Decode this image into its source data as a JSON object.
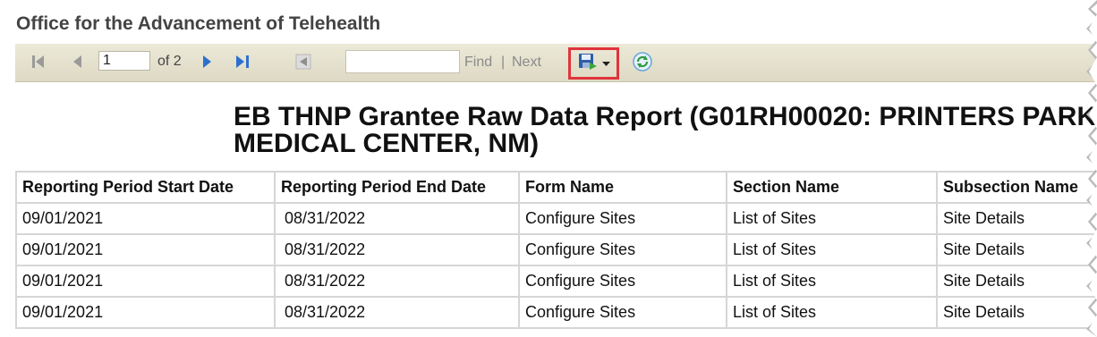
{
  "app": {
    "title": "Office for the Advancement of Telehealth"
  },
  "toolbar": {
    "page_current": "1",
    "page_of": "of 2",
    "find_placeholder": "",
    "find_label": "Find",
    "separator": "|",
    "next_label": "Next",
    "icons": [
      "first-page-icon",
      "previous-page-icon",
      "next-page-icon",
      "last-page-icon",
      "back-to-parent-icon",
      "save-export-icon",
      "dropdown-caret-icon",
      "refresh-icon"
    ],
    "highlight_color": "#e0343a"
  },
  "report": {
    "title_line1": "EB THNP Grantee Raw Data Report (G01RH00020: PRINTERS PARK",
    "title_line2": "MEDICAL CENTER, NM)"
  },
  "table": {
    "headers": [
      "Reporting Period Start Date",
      "Reporting Period End Date",
      "Form Name",
      "Section Name",
      "Subsection Name"
    ],
    "rows": [
      [
        "09/01/2021",
        "08/31/2022",
        "Configure Sites",
        "List of Sites",
        "Site Details"
      ],
      [
        "09/01/2021",
        "08/31/2022",
        "Configure Sites",
        "List of Sites",
        "Site Details"
      ],
      [
        "09/01/2021",
        "08/31/2022",
        "Configure Sites",
        "List of Sites",
        "Site Details"
      ],
      [
        "09/01/2021",
        "08/31/2022",
        "Configure Sites",
        "List of Sites",
        "Site Details"
      ]
    ]
  }
}
